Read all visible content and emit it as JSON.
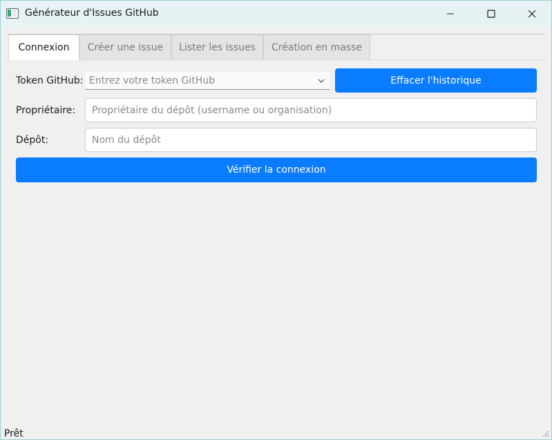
{
  "window": {
    "title": "Générateur d'Issues GitHub",
    "icons": {
      "minimize": "minimize-icon",
      "maximize": "maximize-icon",
      "close": "close-icon",
      "app": "app-window-icon"
    }
  },
  "tabs": [
    {
      "label": "Connexion",
      "active": true
    },
    {
      "label": "Créer une issue",
      "active": false
    },
    {
      "label": "Lister les issues",
      "active": false
    },
    {
      "label": "Création en masse",
      "active": false
    }
  ],
  "form": {
    "token_label": "Token GitHub:",
    "token_placeholder": "Entrez votre token GitHub",
    "clear_history_label": "Effacer l'historique",
    "owner_label": "Propriétaire:",
    "owner_placeholder": "Propriétaire du dépôt (username ou organisation)",
    "repo_label": "Dépôt:",
    "repo_placeholder": "Nom du dépôt",
    "verify_label": "Vérifier la connexion"
  },
  "status": {
    "text": "Prêt"
  },
  "colors": {
    "accent": "#0a7cff",
    "titlebar": "#e6f2f3",
    "background": "#f0f0f0"
  }
}
